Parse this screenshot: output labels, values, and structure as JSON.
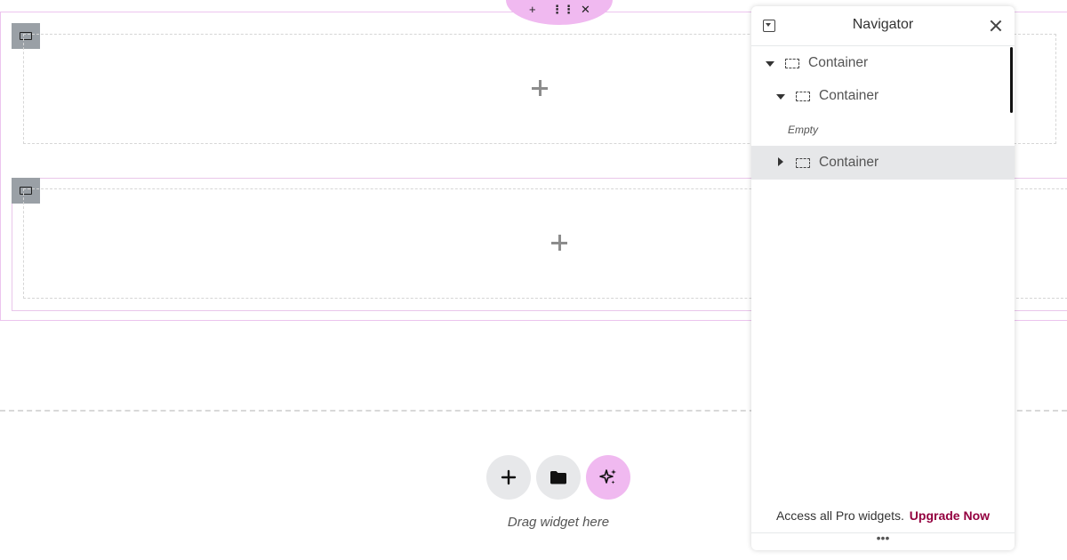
{
  "section_toolbar": {
    "add_icon": "plus-icon",
    "drag_icon": "drag-handle-icon",
    "delete_icon": "close-icon"
  },
  "canvas": {
    "container_icon": "container-icon",
    "add_element_icon": "plus-icon",
    "drop_zone": {
      "buttons": [
        {
          "icon": "plus-icon",
          "bg": "#e7e8ea"
        },
        {
          "icon": "folder-icon",
          "bg": "#e7e8ea"
        },
        {
          "icon": "ai-sparkle-icon",
          "bg": "#f0b9f0"
        }
      ],
      "hint": "Drag widget here"
    }
  },
  "navigator": {
    "title": "Navigator",
    "tree": [
      {
        "label": "Container",
        "expanded": true
      },
      {
        "label": "Container",
        "expanded": true
      },
      {
        "empty_label": "Empty"
      },
      {
        "label": "Container",
        "expanded": false,
        "selected": true
      }
    ],
    "promo_text": "Access all Pro widgets.",
    "upgrade_link": "Upgrade Now",
    "footer": "•••",
    "accent_color": "#93003f"
  }
}
